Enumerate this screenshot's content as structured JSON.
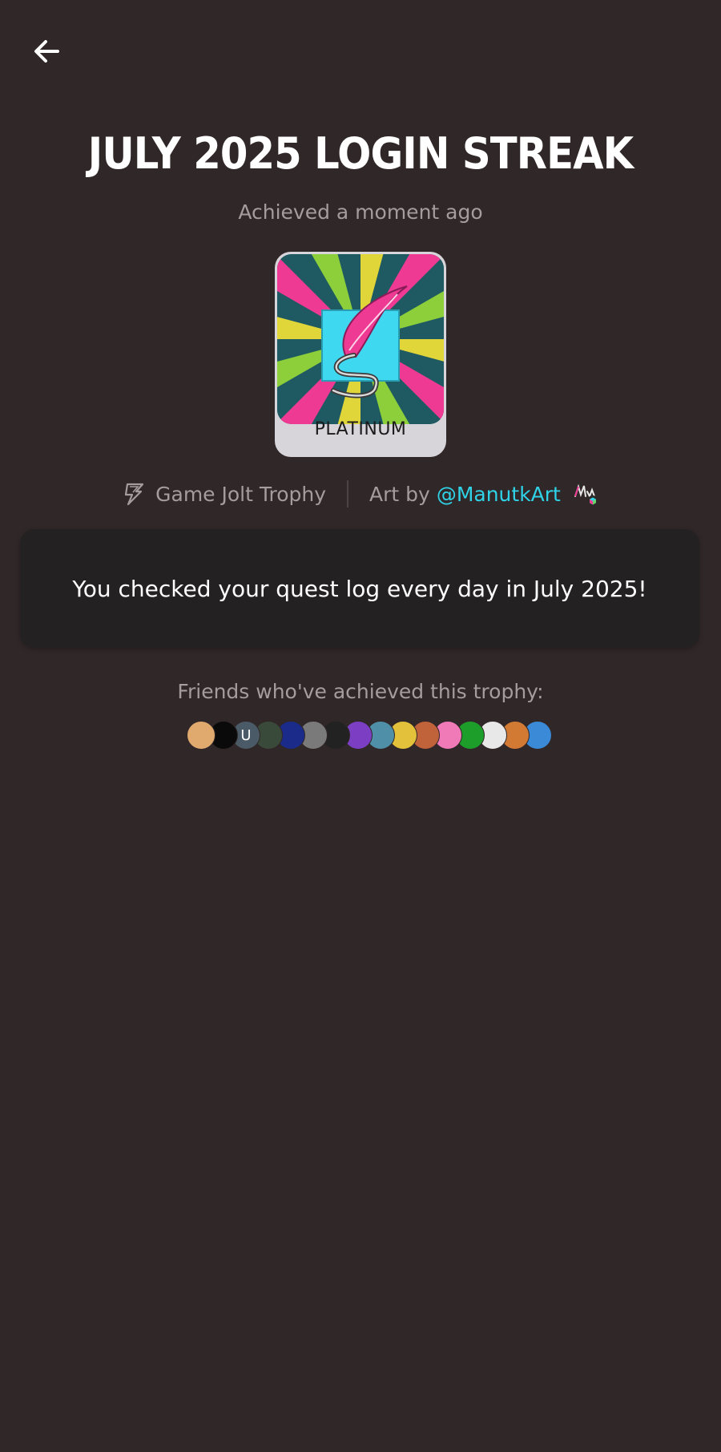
{
  "header": {
    "back_icon": "arrow-left-icon"
  },
  "trophy": {
    "title": "JULY 2025 LOGIN STREAK",
    "achieved": "Achieved a moment ago",
    "tier": "PLATINUM",
    "source_icon": "game-jolt-bolt-icon",
    "source_label": "Game Jolt Trophy",
    "art_by_label": "Art by",
    "artist": "@ManutkArt",
    "description": "You checked your quest log every day in July 2025!"
  },
  "friends": {
    "label": "Friends who've achieved this trophy:",
    "avatars": [
      {
        "color": "#e0a96d",
        "text": ""
      },
      {
        "color": "#0a0a0a",
        "text": ""
      },
      {
        "color": "#4a5a66",
        "text": "U"
      },
      {
        "color": "#3a4a3a",
        "text": ""
      },
      {
        "color": "#1b2b8a",
        "text": ""
      },
      {
        "color": "#7a7a7a",
        "text": ""
      },
      {
        "color": "#222222",
        "text": ""
      },
      {
        "color": "#7c3fc4",
        "text": ""
      },
      {
        "color": "#4f8fa8",
        "text": ""
      },
      {
        "color": "#e3c13a",
        "text": ""
      },
      {
        "color": "#c0623a",
        "text": ""
      },
      {
        "color": "#f07ab8",
        "text": ""
      },
      {
        "color": "#1d9e2a",
        "text": ""
      },
      {
        "color": "#e8e8e8",
        "text": ""
      },
      {
        "color": "#d27a34",
        "text": ""
      },
      {
        "color": "#3a8ad8",
        "text": ""
      }
    ]
  },
  "colors": {
    "background": "#302728",
    "accent": "#2fd3e8",
    "muted_text": "#a49c9d",
    "card": "#232122"
  }
}
